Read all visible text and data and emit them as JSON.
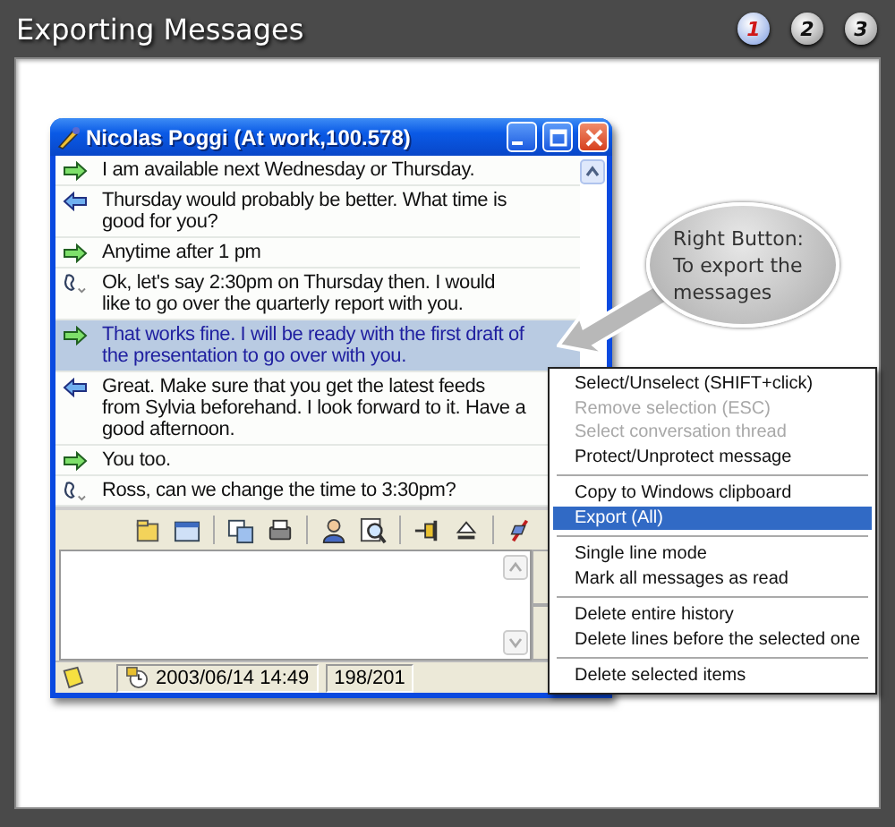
{
  "header": {
    "title": "Exporting Messages",
    "steps": [
      {
        "label": "1",
        "selected": true
      },
      {
        "label": "2",
        "selected": false
      },
      {
        "label": "3",
        "selected": false
      }
    ]
  },
  "chat_window": {
    "title": "Nicolas Poggi (At work,100.578)",
    "messages": [
      {
        "kind": "sent",
        "text": "I am available next Wednesday or Thursday.",
        "selected": false
      },
      {
        "kind": "received",
        "text": "Thursday would probably be better.  What time is good for you?",
        "selected": false
      },
      {
        "kind": "sent",
        "text": "Anytime after 1 pm",
        "selected": false
      },
      {
        "kind": "event",
        "text": "Ok, let's say 2:30pm on Thursday then.  I would like to go over the quarterly report with you.",
        "selected": false
      },
      {
        "kind": "sent",
        "text": "That works fine.  I will be ready with the first draft of the presentation to go over with you.",
        "selected": true
      },
      {
        "kind": "received",
        "text": "Great.  Make sure that you get the latest feeds from Sylvia beforehand.  I look forward to it.  Have a good afternoon.",
        "selected": false
      },
      {
        "kind": "sent",
        "text": "You too.",
        "selected": false
      },
      {
        "kind": "event",
        "text": "Ross, can we change the time to 3:30pm?",
        "selected": false
      }
    ],
    "status_bar": {
      "timestamp": "2003/06/14 14:49",
      "count": "198/201"
    }
  },
  "callout": {
    "text": "Right Button: To export the messages"
  },
  "context_menu": {
    "groups": [
      {
        "items": [
          {
            "label": "Select/Unselect (SHIFT+click)",
            "disabled": false,
            "selected": false
          },
          {
            "label": "Remove selection (ESC)",
            "disabled": true,
            "selected": false
          },
          {
            "label": "Select conversation thread",
            "disabled": true,
            "selected": false
          },
          {
            "label": "Protect/Unprotect message",
            "disabled": false,
            "selected": false
          }
        ]
      },
      {
        "items": [
          {
            "label": "Copy to Windows clipboard",
            "disabled": false,
            "selected": false
          },
          {
            "label": "Export (All)",
            "disabled": false,
            "selected": true
          }
        ]
      },
      {
        "items": [
          {
            "label": "Single line mode",
            "disabled": false,
            "selected": false
          },
          {
            "label": "Mark all messages as read",
            "disabled": false,
            "selected": false
          }
        ]
      },
      {
        "items": [
          {
            "label": "Delete entire history",
            "disabled": false,
            "selected": false
          },
          {
            "label": "Delete lines before the selected one",
            "disabled": false,
            "selected": false
          }
        ]
      },
      {
        "items": [
          {
            "label": "Delete selected items",
            "disabled": false,
            "selected": false
          }
        ]
      }
    ]
  }
}
